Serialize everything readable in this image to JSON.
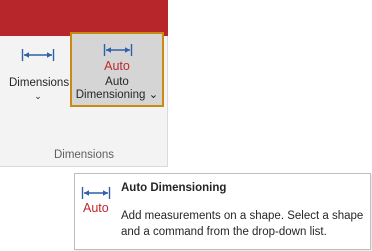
{
  "ribbon": {
    "dimensions_button": {
      "label": "Dimensions",
      "chevron": "⌄",
      "icon": "dimension-line-icon"
    },
    "auto_dimensioning_button": {
      "icon_caption": "Auto",
      "label_line1": "Auto",
      "label_line2": "Dimensioning ⌄",
      "icon": "dimension-line-icon"
    },
    "group_label": "Dimensions"
  },
  "tooltip": {
    "icon": "auto-dimension-icon",
    "icon_caption": "Auto",
    "title": "Auto Dimensioning",
    "description": "Add measurements on a shape. Select a shape and a command from the drop-down list."
  },
  "colors": {
    "title_band": "#b7262a",
    "accent_red": "#c0282d",
    "icon_blue": "#2f5fa8",
    "selected_border": "#c98a10"
  }
}
